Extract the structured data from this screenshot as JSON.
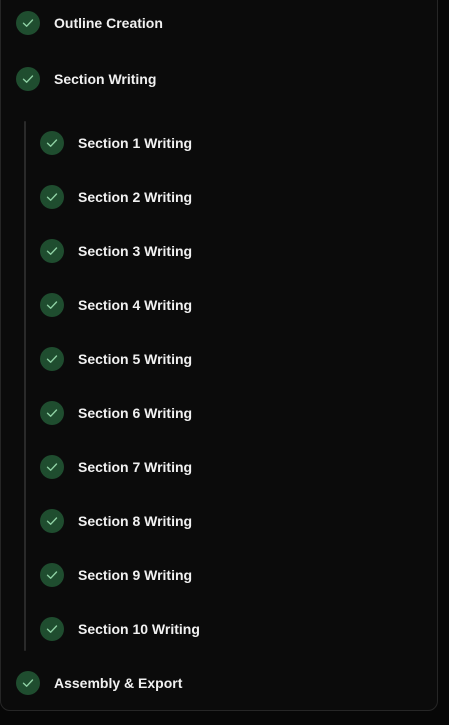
{
  "steps": {
    "outline": {
      "label": "Outline Creation",
      "icon": "check-icon"
    },
    "section_writing": {
      "label": "Section Writing",
      "icon": "check-icon"
    },
    "assembly": {
      "label": "Assembly & Export",
      "icon": "check-icon"
    }
  },
  "sub_steps": [
    {
      "label": "Section 1 Writing"
    },
    {
      "label": "Section 2 Writing"
    },
    {
      "label": "Section 3 Writing"
    },
    {
      "label": "Section 4 Writing"
    },
    {
      "label": "Section 5 Writing"
    },
    {
      "label": "Section 6 Writing"
    },
    {
      "label": "Section 7 Writing"
    },
    {
      "label": "Section 8 Writing"
    },
    {
      "label": "Section 9 Writing"
    },
    {
      "label": "Section 10 Writing"
    }
  ],
  "colors": {
    "background": "#0b0b0b",
    "check_fill": "#1f4d2f",
    "check_mark": "#8fd1a4",
    "text": "#f1f1f1",
    "rail": "#2a2a2a"
  }
}
